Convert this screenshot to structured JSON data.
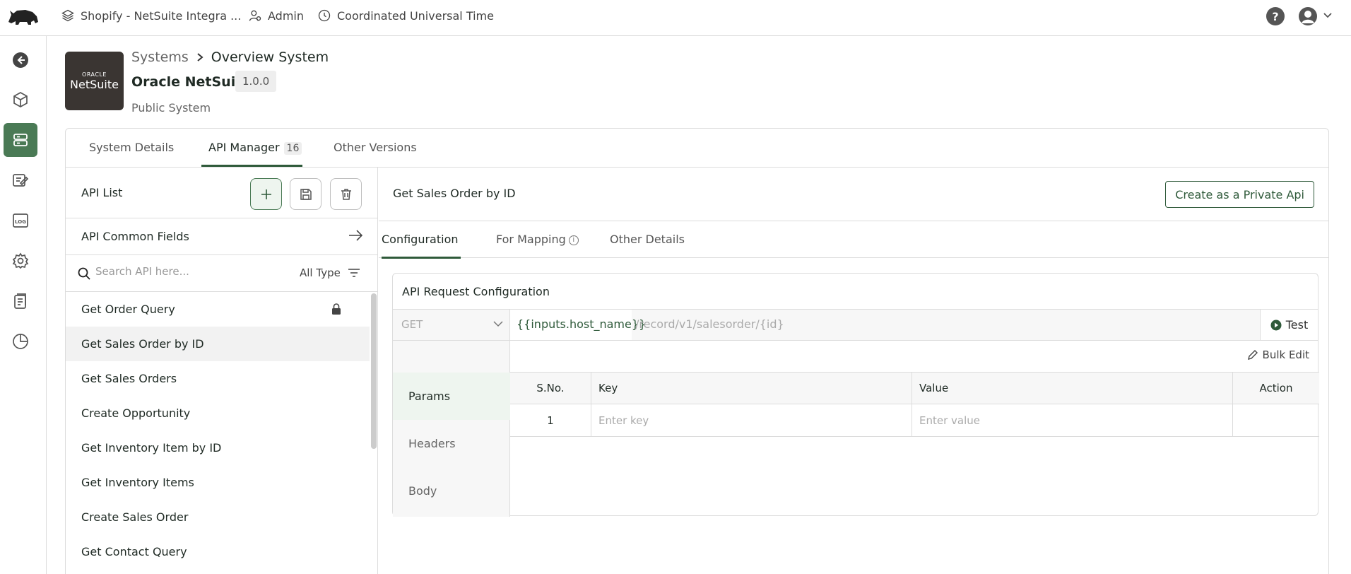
{
  "topbar": {
    "project": "Shopify - NetSuite Integra ...",
    "user_role": "Admin",
    "timezone": "Coordinated Universal Time",
    "icons": [
      "rhino-logo-icon",
      "layers-icon",
      "user-admin-icon",
      "clock-icon",
      "help-icon",
      "avatar-icon",
      "chevron-down-icon"
    ]
  },
  "rail": {
    "items": [
      "back-icon",
      "cube-icon",
      "server-icon",
      "edit-list-icon",
      "log-icon",
      "settings-icon",
      "clipboard-icon",
      "pie-chart-icon"
    ],
    "active": "server-icon",
    "log_label": "LOG"
  },
  "header": {
    "breadcrumb_root": "Systems",
    "breadcrumb_current": "Overview System",
    "system_name": "Oracle NetSuite",
    "version": "1.0.0",
    "subtitle": "Public System",
    "logo_top": "ORACLE",
    "logo_main": "NetSuite"
  },
  "tabs": {
    "system_details": "System Details",
    "api_manager": "API Manager",
    "api_count": "16",
    "other_versions": "Other Versions",
    "active": "api_manager"
  },
  "api_list": {
    "title": "API List",
    "common_fields": "API Common Fields",
    "search_placeholder": "Search API here...",
    "type_filter": "All Type",
    "items": [
      {
        "label": "Get Order Query",
        "locked": true
      },
      {
        "label": "Get Sales Order by ID",
        "selected": true
      },
      {
        "label": "Get Sales Orders"
      },
      {
        "label": "Create Opportunity"
      },
      {
        "label": "Get Inventory Item by ID"
      },
      {
        "label": "Get Inventory Items"
      },
      {
        "label": "Create Sales Order"
      },
      {
        "label": "Get Contact Query"
      }
    ]
  },
  "detail": {
    "title": "Get Sales Order by ID",
    "private_button": "Create as a Private Api",
    "sub_tabs": {
      "configuration": "Configuration",
      "for_mapping": "For Mapping",
      "other_details": "Other Details"
    },
    "request": {
      "title": "API Request Configuration",
      "method": "GET",
      "url_host": "{{inputs.host_name}}",
      "url_path": "/record/v1/salesorder/{id}",
      "test_label": "Test",
      "side_tabs": [
        "Params",
        "Headers",
        "Body"
      ],
      "active_side_tab": "Params",
      "bulk_edit": "Bulk Edit",
      "columns": [
        "S.No.",
        "Key",
        "Value",
        "Action"
      ],
      "rows": [
        {
          "sno": "1",
          "key_placeholder": "Enter key",
          "value_placeholder": "Enter value"
        }
      ]
    }
  },
  "colors": {
    "accent": "#2f5a3a",
    "accent_bg": "#4a7a55",
    "border": "#dcdcdc"
  }
}
